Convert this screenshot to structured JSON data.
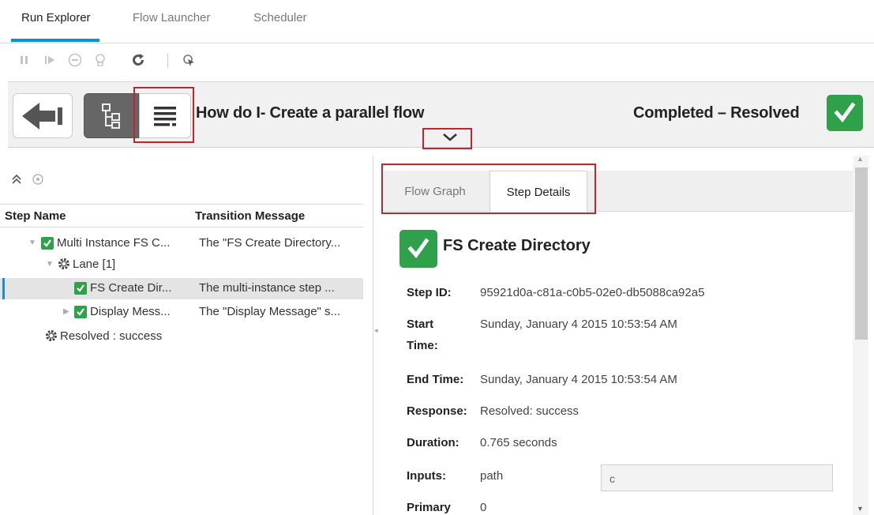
{
  "top_tabs": [
    {
      "label": "Run Explorer",
      "active": true
    },
    {
      "label": "Flow Launcher",
      "active": false
    },
    {
      "label": "Scheduler",
      "active": false
    }
  ],
  "toolbar": {
    "icons": [
      "pause-icon",
      "resume-icon",
      "cancel-icon",
      "reassign-icon",
      "refresh-icon",
      "select-icon"
    ]
  },
  "header": {
    "flow_title": "How do I- Create a parallel flow",
    "status": "Completed – Resolved",
    "status_color": "#2fa14a",
    "highlight_color": "#c0272d"
  },
  "tree": {
    "col_step_name": "Step Name",
    "col_transition": "Transition Message",
    "rows": [
      {
        "name": "Multi Instance FS C...",
        "message": "The \"FS Create Directory...",
        "icon": "check-icon",
        "expanded": true,
        "selected": false
      },
      {
        "name": "Lane [1]",
        "message": "",
        "icon": "gear-icon",
        "expanded": true,
        "selected": false
      },
      {
        "name": "FS Create Dir...",
        "message": "The multi-instance step ...",
        "icon": "check-icon",
        "expanded": false,
        "selected": true
      },
      {
        "name": "Display Mess...",
        "message": "The \"Display Message\" s...",
        "icon": "check-icon",
        "expanded": false,
        "selected": false
      },
      {
        "name": "Resolved : success",
        "message": "",
        "icon": "gear-icon",
        "expanded": false,
        "selected": false
      }
    ]
  },
  "right_tabs": [
    {
      "label": "Flow Graph",
      "active": false
    },
    {
      "label": "Step Details",
      "active": true
    }
  ],
  "details": {
    "title": "FS Create Directory",
    "step_id_label": "Step ID:",
    "step_id": "95921d0a-c81a-c0b5-02e0-db5088ca92a5",
    "start_label_1": "Start",
    "start_label_2": "Time:",
    "start_time": "Sunday, January 4 2015 10:53:54 AM",
    "end_label": "End Time:",
    "end_time": "Sunday, January 4 2015 10:53:54 AM",
    "response_label": "Response:",
    "response": "Resolved: success",
    "duration_label": "Duration:",
    "duration": "0.765 seconds",
    "inputs_label": "Inputs:",
    "input_name": "path",
    "input_value": "c",
    "primary_label": "Primary",
    "primary_value": "0"
  }
}
